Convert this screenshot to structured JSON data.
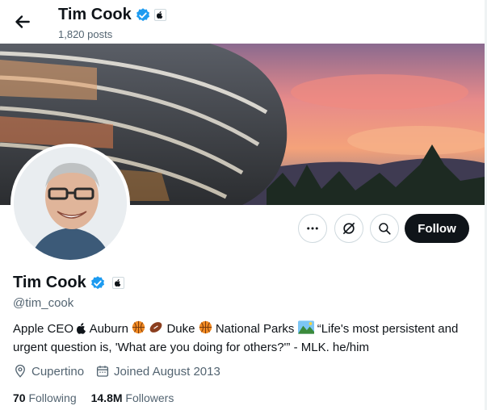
{
  "header": {
    "title": "Tim Cook",
    "posts": "1,820 posts"
  },
  "profile": {
    "name": "Tim Cook",
    "handle": "@tim_cook",
    "bio": {
      "p1": "Apple CEO",
      "p2": "Auburn",
      "p3": "Duke",
      "p4": "National Parks",
      "p5": "“Life's most persistent and urgent question is, 'What are you doing for others?'” - MLK. he/him"
    },
    "location": "Cupertino",
    "joined": "Joined August 2013",
    "following_count": "70",
    "following_label": "Following",
    "followers_count": "14.8M",
    "followers_label": "Followers"
  },
  "actions": {
    "follow_label": "Follow"
  },
  "icons": [
    "back-arrow-icon",
    "verified-badge-icon",
    "apple-affiliate-icon",
    "more-icon",
    "grok-icon",
    "search-icon",
    "location-icon",
    "calendar-icon"
  ],
  "colors": {
    "verified": "#1d9bf0",
    "follow_bg": "#0f1419",
    "muted": "#536471"
  }
}
